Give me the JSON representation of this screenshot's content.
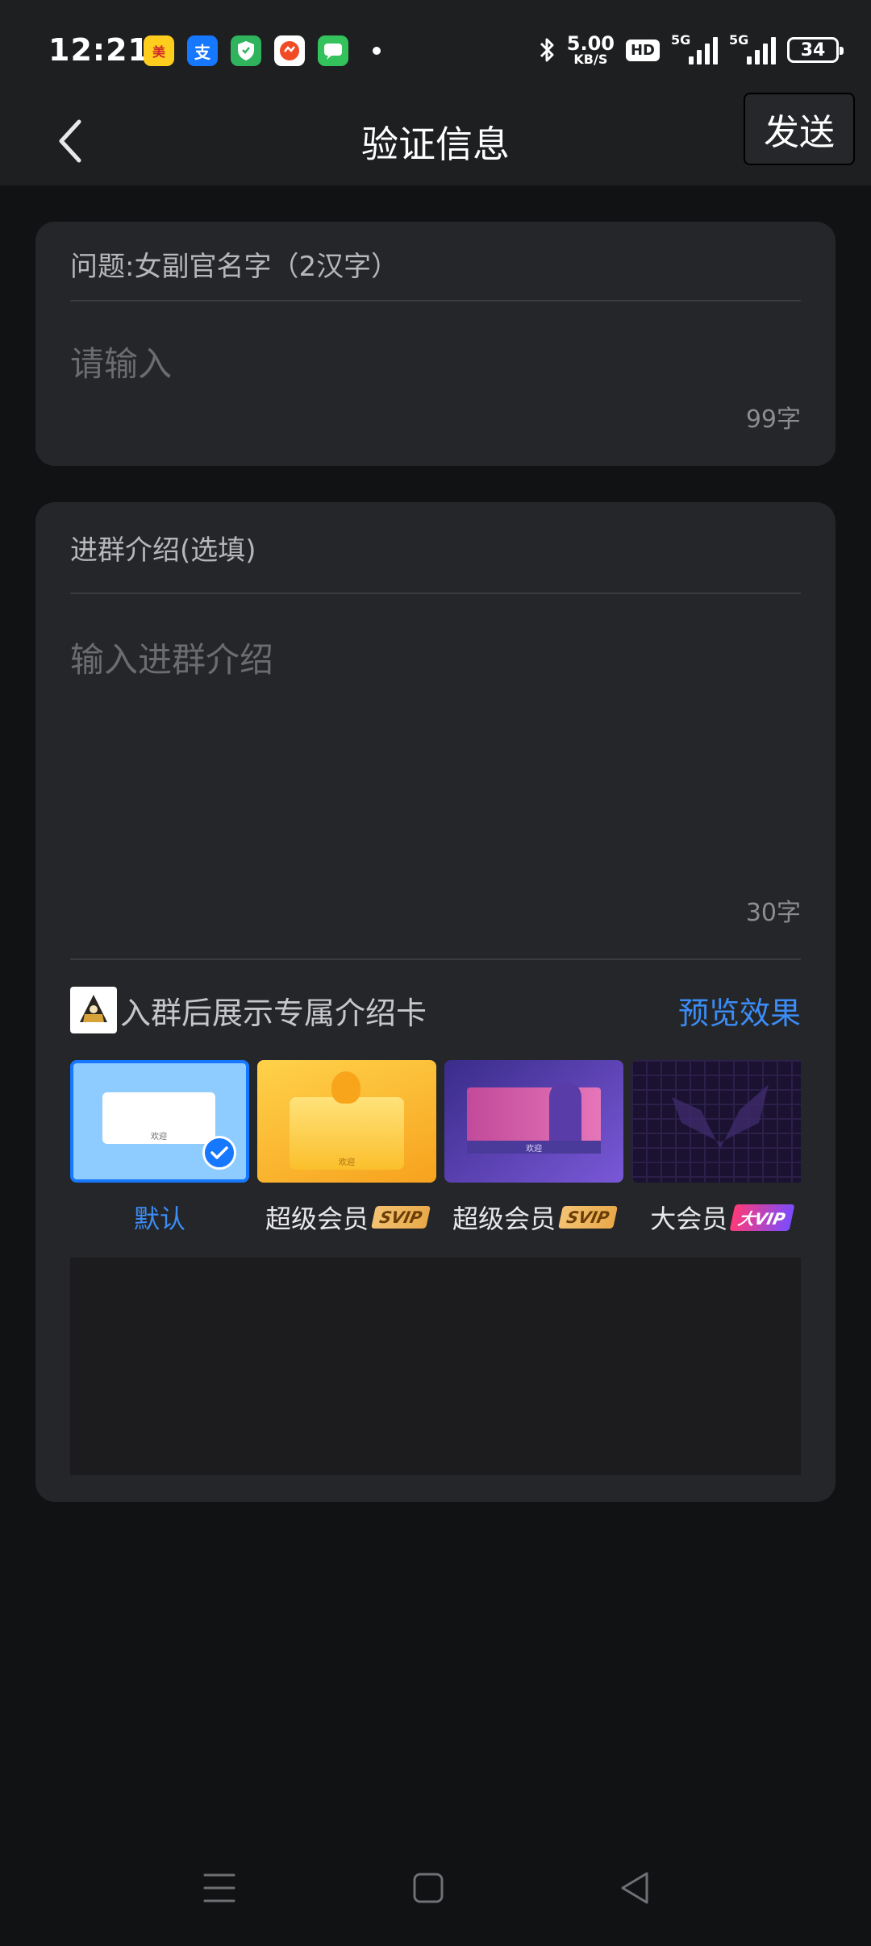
{
  "status_bar": {
    "time": "12:21",
    "net_speed": "5.00",
    "net_unit": "KB/S",
    "hd_label": "HD",
    "sig1_label": "5G",
    "sig2_label": "5G",
    "battery": "34"
  },
  "nav": {
    "title": "验证信息",
    "send_label": "发送",
    "back_icon": "chevron-left-icon"
  },
  "question_card": {
    "label": "问题:女副官名字（2汉字）",
    "placeholder": "请输入",
    "counter": "99字"
  },
  "intro_card": {
    "label": "进群介绍(选填)",
    "placeholder": "输入进群介绍",
    "counter": "30字",
    "card_row_text": "入群后展示专属介绍卡",
    "preview_label": "预览效果",
    "options": [
      {
        "label": "默认",
        "badge": "",
        "selected": true
      },
      {
        "label": "超级会员",
        "badge": "SVIP",
        "selected": false
      },
      {
        "label": "超级会员",
        "badge": "SVIP",
        "selected": false
      },
      {
        "label": "大会员",
        "badge": "大VIP",
        "selected": false
      }
    ],
    "thumb_text": "欢迎"
  },
  "colors": {
    "accent": "#3b8cf5",
    "card_bg": "#252629",
    "page_bg": "#111214"
  }
}
